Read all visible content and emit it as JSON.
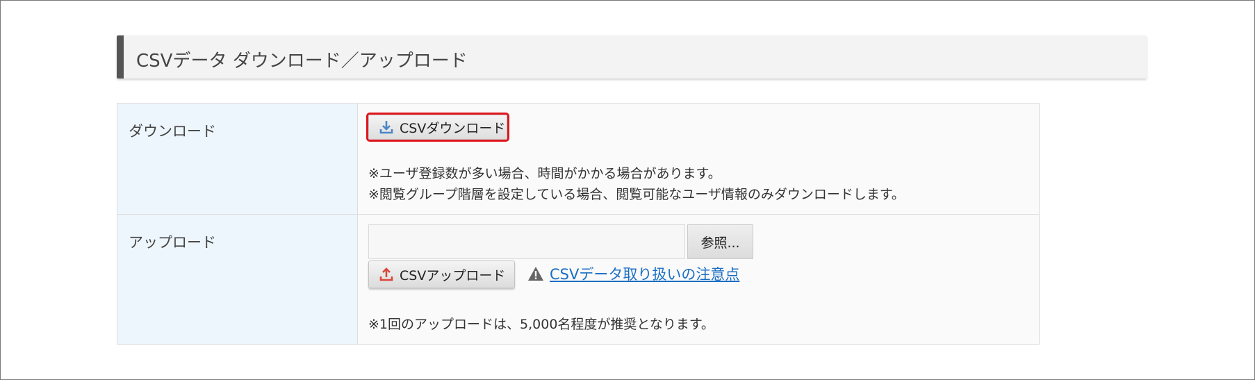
{
  "section": {
    "title": "CSVデータ ダウンロード／アップロード"
  },
  "download": {
    "label": "ダウンロード",
    "button_label": "CSVダウンロード",
    "button_icon": "download-icon",
    "notes": [
      "※ユーザ登録数が多い場合、時間がかかる場合があります。",
      "※閲覧グループ階層を設定している場合、閲覧可能なユーザ情報のみダウンロードします。"
    ]
  },
  "upload": {
    "label": "アップロード",
    "file_value": "",
    "browse_label": "参照...",
    "button_label": "CSVアップロード",
    "button_icon": "upload-icon",
    "warning_icon": "warning-icon",
    "link_text": "CSVデータ取り扱いの注意点",
    "note": "※1回のアップロードは、5,000名程度が推奨となります。"
  },
  "colors": {
    "download_icon": "#4a86c5",
    "upload_icon": "#d9463b",
    "highlight": "#e0151c",
    "link": "#1a6ec4"
  }
}
